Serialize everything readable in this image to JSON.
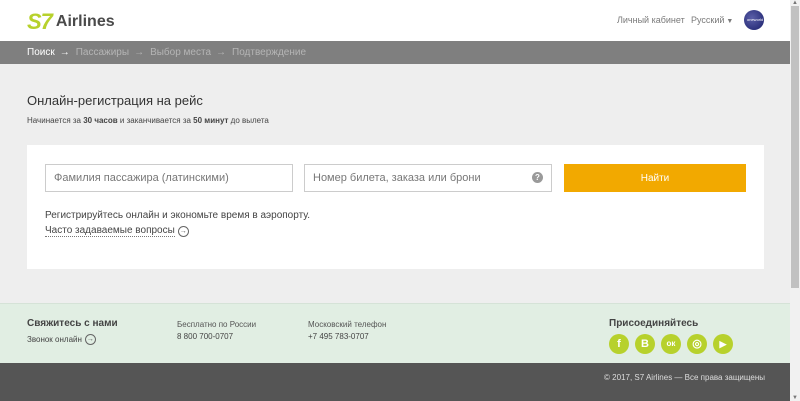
{
  "header": {
    "logo_mark": "S7",
    "logo_text": "Airlines",
    "cabinet": "Личный кабинет",
    "language": "Русский",
    "oneworld": "oneworld"
  },
  "steps": [
    {
      "label": "Поиск",
      "active": true
    },
    {
      "label": "Пассажиры",
      "active": false
    },
    {
      "label": "Выбор места",
      "active": false
    },
    {
      "label": "Подтверждение",
      "active": false
    }
  ],
  "main": {
    "title": "Онлайн-регистрация на рейс",
    "subtitle_pre": "Начинается за ",
    "subtitle_b1": "30 часов",
    "subtitle_mid": " и заканчивается за ",
    "subtitle_b2": "50 минут",
    "subtitle_post": " до вылета"
  },
  "form": {
    "name_placeholder": "Фамилия пассажира (латинскими)",
    "ticket_placeholder": "Номер билета, заказа или брони",
    "help": "?",
    "find_button": "Найти",
    "promo": "Регистрируйтесь онлайн и экономьте время в аэропорту.",
    "faq": "Часто задаваемые вопросы"
  },
  "footer": {
    "contact_title": "Свяжитесь с нами",
    "call_online": "Звонок онлайн",
    "russia_label": "Бесплатно по России",
    "russia_phone": "8 800 700-0707",
    "moscow_label": "Московский телефон",
    "moscow_phone": "+7 495 783-0707",
    "join_title": "Присоединяйтесь",
    "socials": [
      {
        "icon": "facebook-icon",
        "glyph": "f"
      },
      {
        "icon": "vk-icon",
        "glyph": "В"
      },
      {
        "icon": "odnoklassniki-icon",
        "glyph": "ок"
      },
      {
        "icon": "instagram-icon",
        "glyph": "◎"
      },
      {
        "icon": "youtube-icon",
        "glyph": "▶"
      }
    ],
    "copyright": "© 2017, S7 Airlines — Все права защищены"
  },
  "colors": {
    "accent": "#b7d12c",
    "button": "#f2a900",
    "steps_bar": "#7f7f7f",
    "footer_bg": "#e1eee3"
  }
}
